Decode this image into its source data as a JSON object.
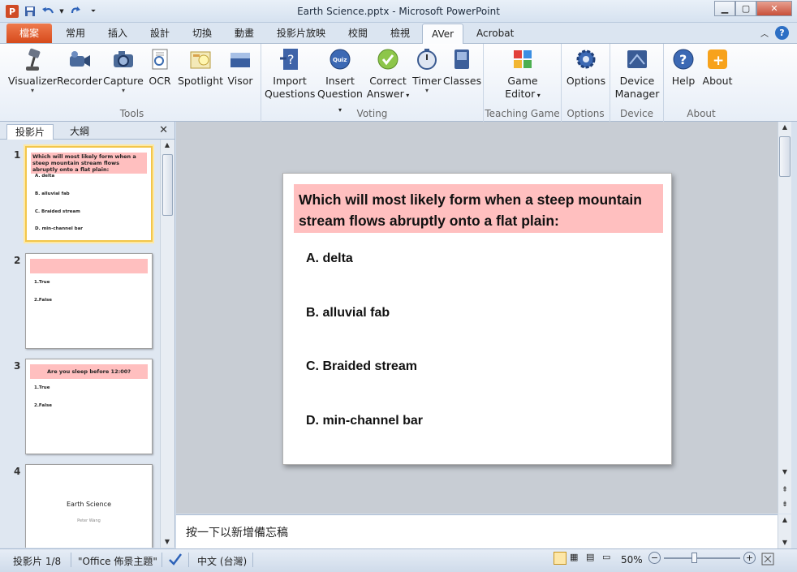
{
  "window": {
    "title": "Earth Science.pptx - Microsoft PowerPoint"
  },
  "tabs": [
    {
      "label": "檔案"
    },
    {
      "label": "常用"
    },
    {
      "label": "插入"
    },
    {
      "label": "設計"
    },
    {
      "label": "切換"
    },
    {
      "label": "動畫"
    },
    {
      "label": "投影片放映"
    },
    {
      "label": "校閱"
    },
    {
      "label": "檢視"
    },
    {
      "label": "AVer"
    },
    {
      "label": "Acrobat"
    }
  ],
  "ribbon": {
    "groups": [
      {
        "label": "Tools",
        "buttons": [
          {
            "label": "Visualizer"
          },
          {
            "label": "Recorder"
          },
          {
            "label": "Capture"
          },
          {
            "label": "OCR"
          },
          {
            "label": "Spotlight"
          },
          {
            "label": "Visor"
          }
        ]
      },
      {
        "label": "Voting",
        "buttons": [
          {
            "label": "Import",
            "label2": "Questions"
          },
          {
            "label": "Insert",
            "label2": "Question"
          },
          {
            "label": "Correct",
            "label2": "Answer"
          },
          {
            "label": "Timer"
          },
          {
            "label": "Classes"
          }
        ]
      },
      {
        "label": "Teaching Game",
        "buttons": [
          {
            "label": "Game",
            "label2": "Editor"
          }
        ]
      },
      {
        "label": "Options",
        "buttons": [
          {
            "label": "Options"
          }
        ]
      },
      {
        "label": "Device",
        "buttons": [
          {
            "label": "Device",
            "label2": "Manager"
          }
        ]
      },
      {
        "label": "About",
        "buttons": [
          {
            "label": "Help"
          },
          {
            "label": "About"
          }
        ]
      }
    ]
  },
  "panel": {
    "tabs": [
      {
        "label": "投影片"
      },
      {
        "label": "大綱"
      }
    ]
  },
  "thumbnails": [
    {
      "num": "1",
      "title": "Which will most likely form when a steep mountain stream flows abruptly onto a flat plain:",
      "options": [
        "A. delta",
        "B. alluvial fab",
        "C. Braided stream",
        "D. min-channel bar"
      ]
    },
    {
      "num": "2",
      "title": "",
      "options": [
        "1.True",
        "2.False"
      ]
    },
    {
      "num": "3",
      "title": "Are you sleep before 12:00?",
      "options": [
        "1.True",
        "2.False"
      ]
    },
    {
      "num": "4",
      "title": "Earth Science",
      "subtitle": "Peter Wang"
    }
  ],
  "slide": {
    "question": "Which will most likely form when a steep mountain stream flows abruptly onto a flat plain:",
    "options": [
      "A. delta",
      "B. alluvial fab",
      "C. Braided stream",
      "D. min-channel bar"
    ]
  },
  "notes": {
    "placeholder": "按一下以新增備忘稿"
  },
  "status": {
    "slide": "投影片 1/8",
    "theme": "\"Office 佈景主題\"",
    "language": "中文 (台灣)",
    "zoom": "50%"
  },
  "colors": {
    "accent_tab": "#d64a1c",
    "question_bg": "#ffbfbf"
  }
}
